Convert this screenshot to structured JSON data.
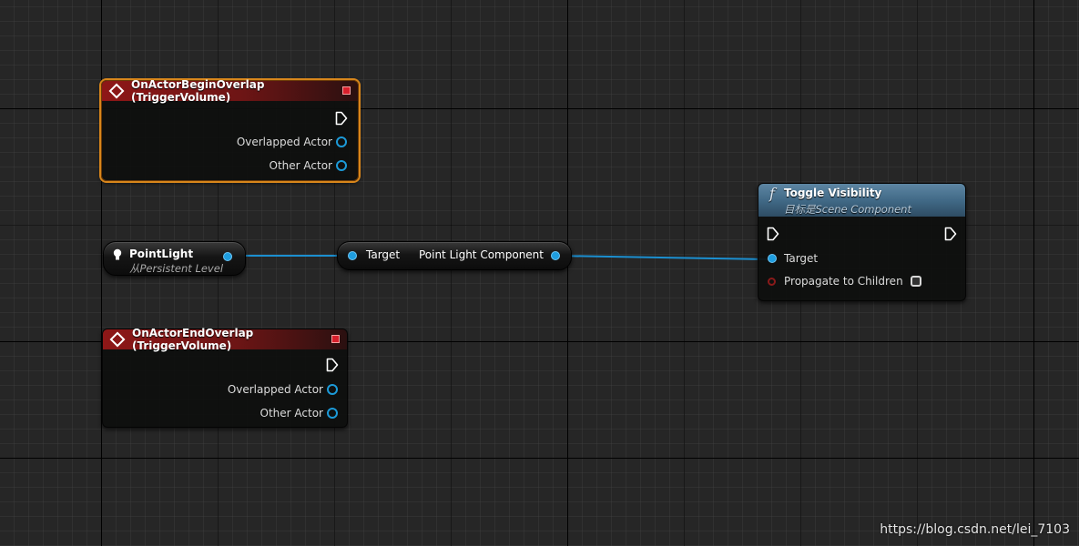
{
  "begin_overlap": {
    "title": "OnActorBeginOverlap (TriggerVolume)",
    "pins": [
      "Overlapped Actor",
      "Other Actor"
    ]
  },
  "end_overlap": {
    "title": "OnActorEndOverlap (TriggerVolume)",
    "pins": [
      "Overlapped Actor",
      "Other Actor"
    ]
  },
  "point_light": {
    "title": "PointLight",
    "subtitle": "从Persistent Level"
  },
  "get_component": {
    "input": "Target",
    "output": "Point Light Component"
  },
  "toggle_visibility": {
    "icon": "f",
    "title": "Toggle Visibility",
    "subtitle": "目标是Scene Component",
    "pins": [
      "Target",
      "Propagate to Children"
    ],
    "propagate_checked": false
  },
  "watermark": "https://blog.csdn.net/lei_7103",
  "colors": {
    "event_header": "#8e1717",
    "function_header": "#3f6784",
    "object_pin": "#1f9ee0",
    "selection": "#d8861b",
    "bool_pin": "#8a1a1a"
  }
}
